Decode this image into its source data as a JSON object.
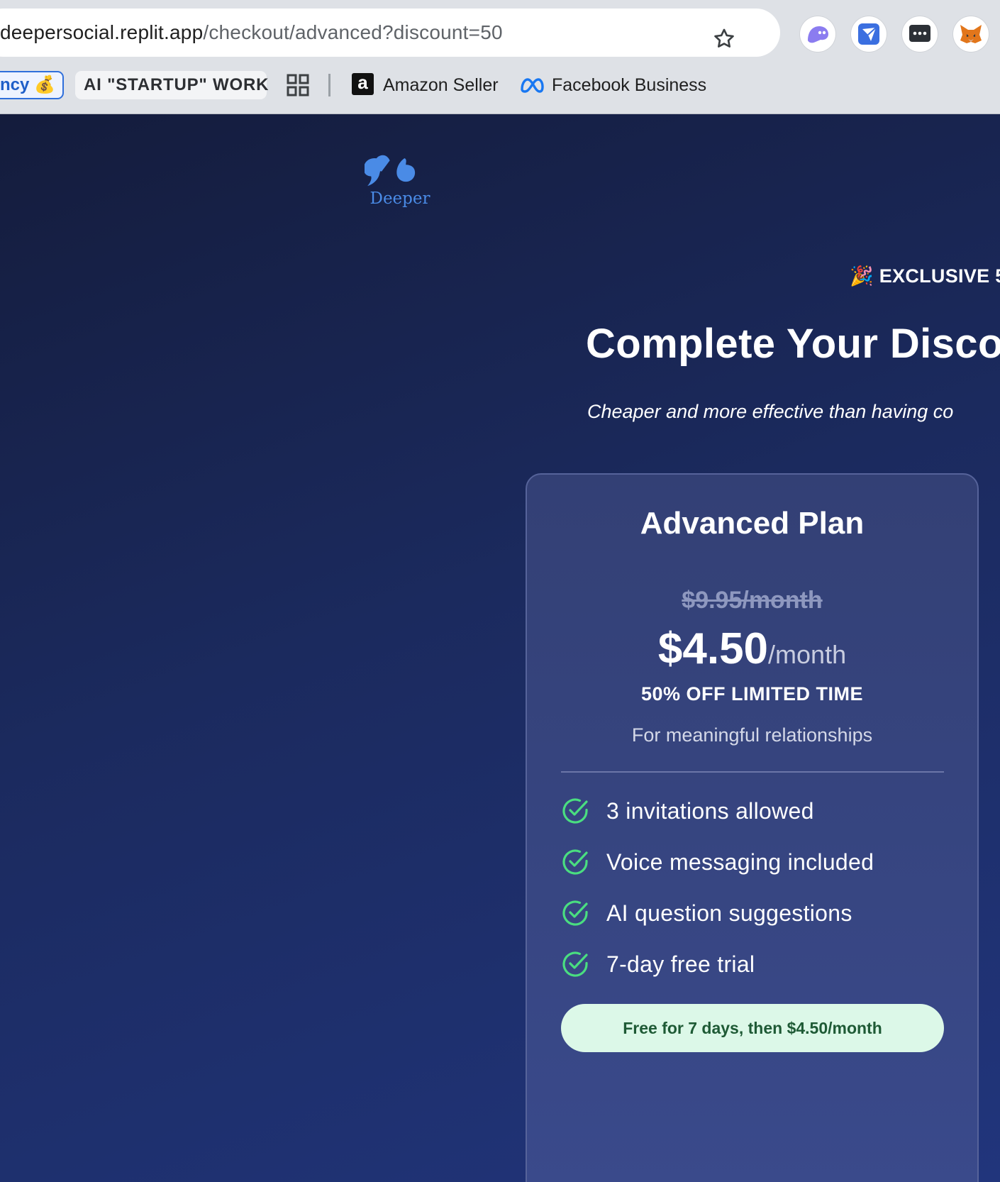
{
  "browser": {
    "url_host": "deepersocial.replit.app",
    "url_path": "/checkout/advanced?discount=50",
    "bookmarks": {
      "chip_blue": "ncy 💰",
      "chip_gray": "AI \"STARTUP\" WORK",
      "amazon": "Amazon Seller",
      "facebook": "Facebook Business"
    },
    "icons": [
      "star-icon",
      "ghost-extension-icon",
      "send-extension-icon",
      "chat-extension-icon",
      "fox-extension-icon",
      "apps-grid-icon",
      "amazon-icon",
      "meta-icon"
    ]
  },
  "page": {
    "logo_text": "Deeper",
    "promo": "🎉 EXCLUSIVE 5",
    "headline": "Complete Your Disco",
    "subhead": "Cheaper and more effective than having co"
  },
  "plan": {
    "title": "Advanced Plan",
    "old_price": "$9.95/month",
    "price": "$4.50",
    "price_unit": "/month",
    "discount_label": "50% OFF LIMITED TIME",
    "tagline": "For meaningful relationships",
    "features": [
      "3 invitations allowed",
      "Voice messaging included",
      "AI question suggestions",
      "7-day free trial"
    ],
    "cta": "Free for 7 days, then $4.50/month"
  },
  "colors": {
    "accent_green": "#4ade80",
    "cta_bg": "#dcf8e8",
    "cta_text": "#1e5a35",
    "logo_blue": "#4a8be6",
    "page_bg": "#1b2a5e"
  }
}
